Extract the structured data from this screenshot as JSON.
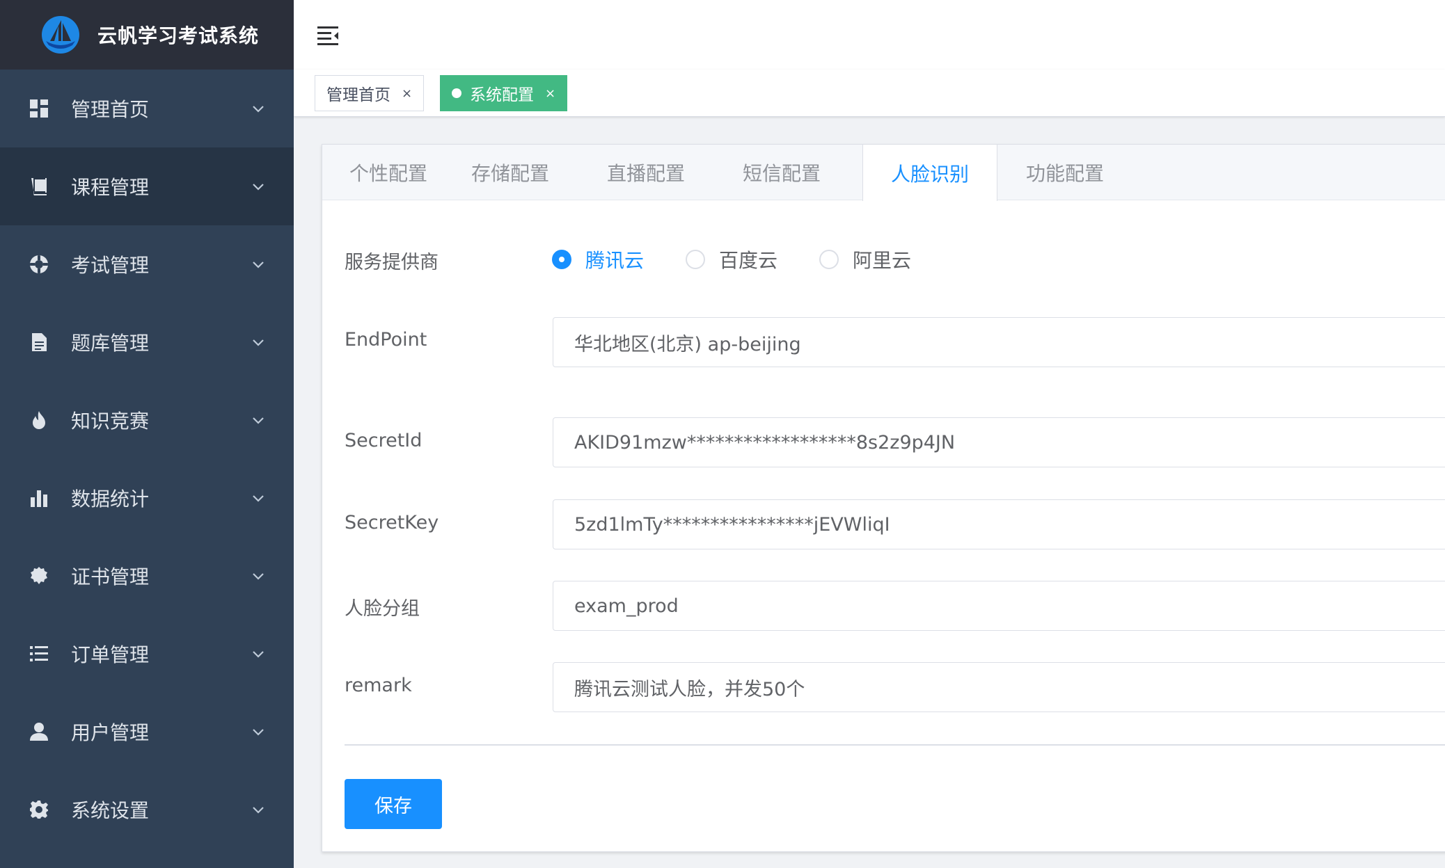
{
  "app": {
    "title": "云帆学习考试系统"
  },
  "sidebar": {
    "items": [
      {
        "label": "管理首页",
        "icon": "dashboard-icon"
      },
      {
        "label": "课程管理",
        "icon": "book-icon"
      },
      {
        "label": "考试管理",
        "icon": "exam-icon"
      },
      {
        "label": "题库管理",
        "icon": "document-icon"
      },
      {
        "label": "知识竞赛",
        "icon": "fire-icon"
      },
      {
        "label": "数据统计",
        "icon": "bar-chart-icon"
      },
      {
        "label": "证书管理",
        "icon": "certificate-icon"
      },
      {
        "label": "订单管理",
        "icon": "list-icon"
      },
      {
        "label": "用户管理",
        "icon": "user-icon"
      },
      {
        "label": "系统设置",
        "icon": "gear-icon"
      }
    ]
  },
  "tags": [
    {
      "label": "管理首页",
      "close": "×"
    },
    {
      "label": "系统配置",
      "close": "×"
    }
  ],
  "tabs": [
    {
      "label": "个性配置"
    },
    {
      "label": "存储配置"
    },
    {
      "label": "直播配置"
    },
    {
      "label": "短信配置"
    },
    {
      "label": "人脸识别"
    },
    {
      "label": "功能配置"
    }
  ],
  "form": {
    "provider_label": "服务提供商",
    "providers": [
      "腾讯云",
      "百度云",
      "阿里云"
    ],
    "selected_provider": "腾讯云",
    "endpoint_label": "EndPoint",
    "endpoint_value": "华北地区(北京) ap-beijing",
    "secret_id_label": "SecretId",
    "secret_id_value": "AKID91mzw******************8s2z9p4JN",
    "secret_key_label": "SecretKey",
    "secret_key_value": "5zd1lmTy****************jEVWliqI",
    "group_label": "人脸分组",
    "group_value": "exam_prod",
    "remark_label": "remark",
    "remark_value": "腾讯云测试人脸，并发50个",
    "save_label": "保存"
  },
  "colors": {
    "primary": "#1890ff",
    "sidebar_bg": "#304156",
    "tag_active": "#42b983"
  }
}
